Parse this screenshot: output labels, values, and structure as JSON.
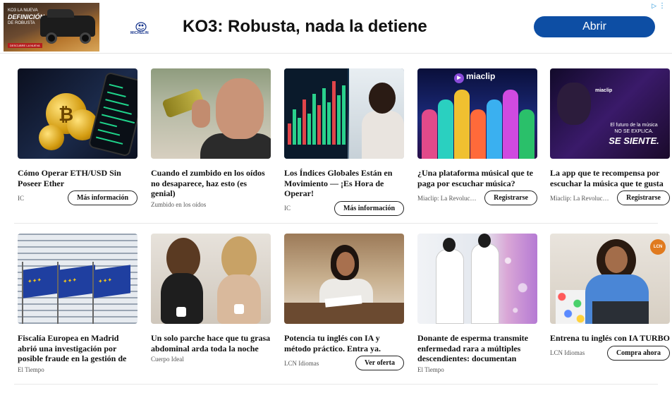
{
  "ad": {
    "thumb_line1": "KO3 LA NUEVA",
    "thumb_line2": "DEFINICIÓN",
    "thumb_line3": "DE ROBUSTA",
    "thumb_cta": "DESCUBRE LA NUEVA",
    "brand": "MICHELIN",
    "headline": "KO3: Robusta, nada la detiene",
    "cta_label": "Abrir",
    "choices_icon": "adchoices-icon",
    "more_icon": "more-vertical-icon"
  },
  "cards": [
    {
      "title": "Cómo Operar ETH/USD Sin Poseer Ether",
      "source": "IC",
      "cta": "Más información",
      "thumb": "crypto"
    },
    {
      "title": "Cuando el zumbido en los oídos no desaparece, haz esto (es genial)",
      "source": "Zumbido en los oídos",
      "cta": "",
      "thumb": "ear"
    },
    {
      "title": "Los Índices Globales Están en Movimiento — ¡Es Hora de Operar!",
      "source": "IC",
      "cta": "Más información",
      "thumb": "index"
    },
    {
      "title": "¿Una plataforma músical que te paga por escuchar música?",
      "source": "Miaclip: La Revolución",
      "cta": "Registrarse",
      "thumb": "miaclip1",
      "thumb_logo": "miaclip"
    },
    {
      "title": "La app que te recompensa por escuchar la música que te gusta",
      "source": "Miaclip: La Revolución",
      "cta": "Registrarse",
      "thumb": "miaclip2",
      "thumb_logo": "miaclip",
      "thumb_line1": "El futuro de la música\nNO SE EXPLICA.",
      "thumb_line2": "SE SIENTE."
    },
    {
      "title": "Fiscalía Europea en Madrid abrió una investigación por posible fraude en la gestión de fondos de ...",
      "source": "El Tiempo",
      "cta": "",
      "thumb": "eu"
    },
    {
      "title": "Un solo parche hace que tu grasa abdominal arda toda la noche",
      "source": "Cuerpo Ideal",
      "cta": "",
      "thumb": "patch"
    },
    {
      "title": "Potencia tu inglés con IA y método práctico. Entra ya.",
      "source": "LCN Idiomas",
      "cta": "Ver oferta",
      "thumb": "english"
    },
    {
      "title": "Donante de esperma transmite enfermedad rara a múltiples descendientes: documentan prim...",
      "source": "El Tiempo",
      "cta": "",
      "thumb": "lab"
    },
    {
      "title": "Entrena tu inglés con IA TURBO",
      "source": "LCN Idiomas",
      "cta": "Compra ahora",
      "thumb": "lcn",
      "thumb_logo": "LCN"
    }
  ]
}
